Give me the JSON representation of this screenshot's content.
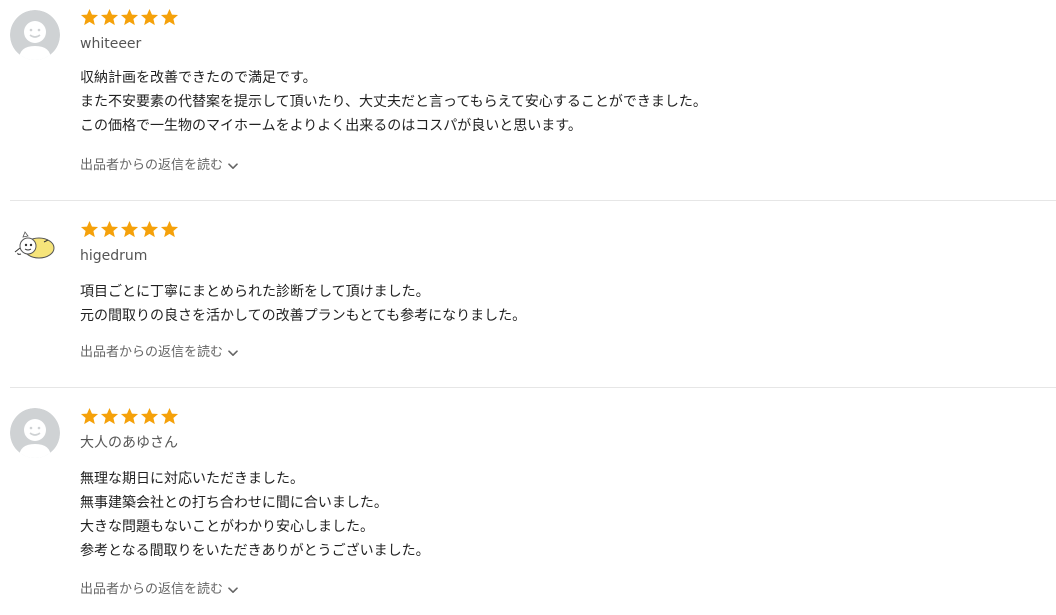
{
  "colors": {
    "star": "#f5a10a",
    "avatar_bg": "#cfd2d4",
    "avatar_fg": "#ffffff",
    "divider": "#e6e6e6"
  },
  "reviews": [
    {
      "username": "whiteeer",
      "rating": 5,
      "avatar_icon": "default-user-icon",
      "lines": [
        "収納計画を改善できたので満足です。",
        "また不安要素の代替案を提示して頂いたり、大丈夫だと言ってもらえて安心することができました。",
        "この価格で一生物のマイホームをよりよく出来るのはコスパが良いと思います。"
      ],
      "reply_label": "出品者からの返信を読む"
    },
    {
      "username": "higedrum",
      "rating": 5,
      "avatar_icon": "yellow-character-icon",
      "lines": [
        "項目ごとに丁寧にまとめられた診断をして頂けました。",
        "元の間取りの良さを活かしての改善プランもとても参考になりました。"
      ],
      "reply_label": "出品者からの返信を読む"
    },
    {
      "username": "大人のあゆさん",
      "rating": 5,
      "avatar_icon": "default-user-icon",
      "lines": [
        "無理な期日に対応いただきました。",
        "無事建築会社との打ち合わせに間に合いました。",
        "大きな問題もないことがわかり安心しました。",
        "参考となる間取りをいただきありがとうございました。"
      ],
      "reply_label": "出品者からの返信を読む"
    }
  ]
}
